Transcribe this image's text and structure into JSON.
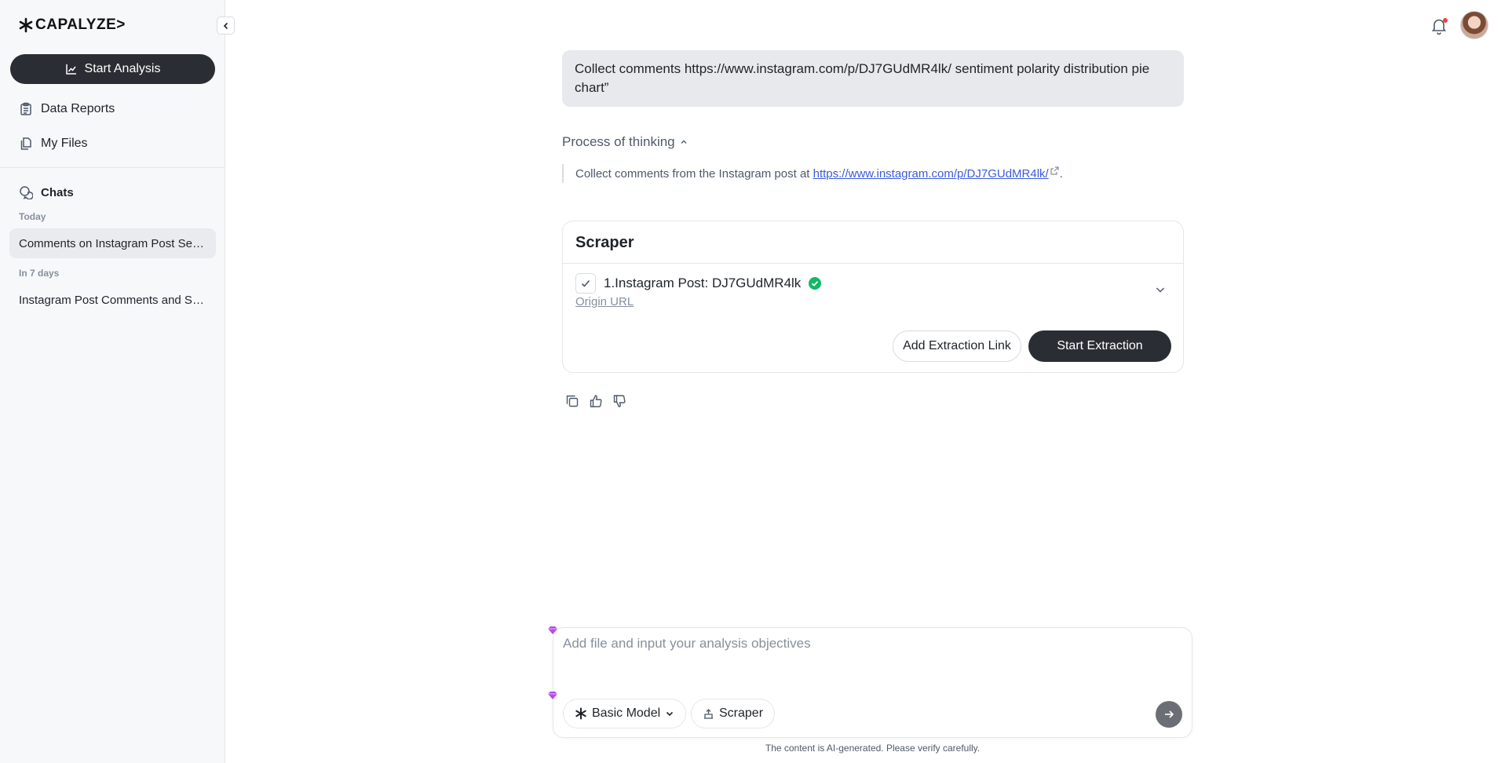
{
  "brand": {
    "logo_text": "CAPALYZE>"
  },
  "sidebar": {
    "start_analysis_label": "Start Analysis",
    "nav": [
      {
        "label": "Data Reports",
        "icon": "clipboard-icon"
      },
      {
        "label": "My Files",
        "icon": "files-icon"
      }
    ],
    "chats_label": "Chats",
    "groups": [
      {
        "label": "Today",
        "items": [
          {
            "title": "Comments on Instagram Post Sen...",
            "active": true
          }
        ]
      },
      {
        "label": "In 7 days",
        "items": [
          {
            "title": "Instagram Post Comments and Se...",
            "active": false
          }
        ]
      }
    ]
  },
  "conversation": {
    "user_message": "Collect comments https://www.instagram.com/p/DJ7GUdMR4lk/ sentiment polarity distribution pie chart”",
    "thinking": {
      "header": "Process of thinking",
      "text_before": "Collect comments from the Instagram post at",
      "link_text": "https://www.instagram.com/p/DJ7GUdMR4lk/",
      "text_after": "."
    },
    "scraper": {
      "title": "Scraper",
      "item_title": "1.Instagram Post: DJ7GUdMR4lk",
      "origin_label": "Origin URL",
      "add_link_label": "Add Extraction Link",
      "start_label": "Start Extraction"
    }
  },
  "composer": {
    "placeholder": "Add file and input your analysis objectives",
    "model_label": "Basic Model",
    "tool_label": "Scraper"
  },
  "footer": {
    "disclaimer": "The content is AI-generated. Please verify carefully."
  },
  "colors": {
    "dark": "#2a2d33",
    "link": "#3b5bdb",
    "success": "#12b76a",
    "badge": "#f53f3f"
  }
}
